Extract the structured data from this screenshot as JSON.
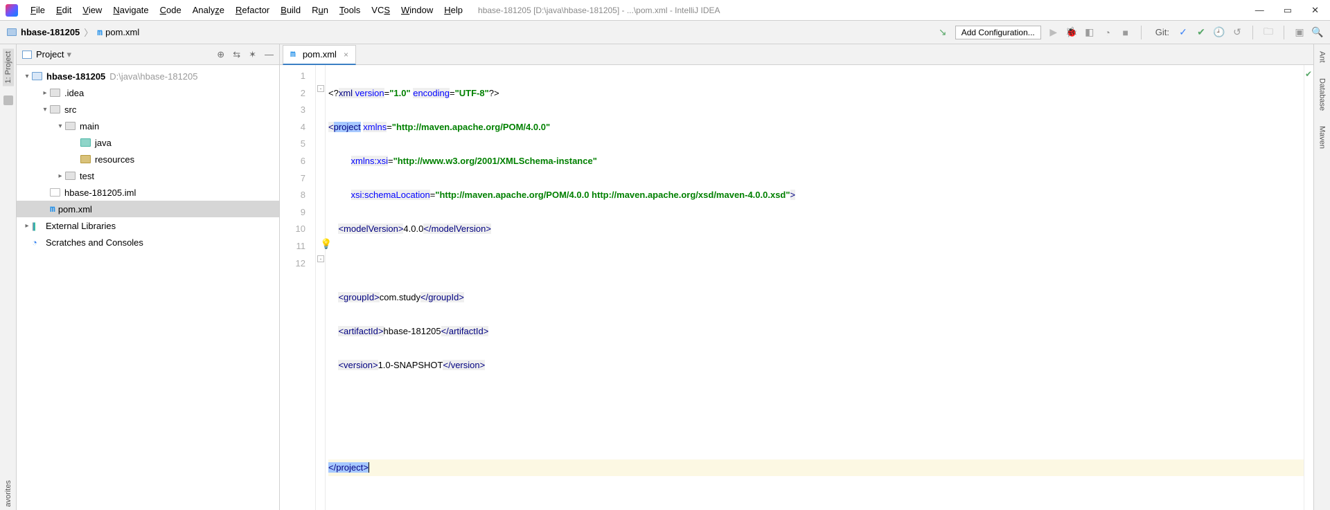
{
  "menus": {
    "file": "File",
    "edit": "Edit",
    "view": "View",
    "navigate": "Navigate",
    "code": "Code",
    "analyze": "Analyze",
    "refactor": "Refactor",
    "build": "Build",
    "run": "Run",
    "tools": "Tools",
    "vcs": "VCS",
    "window": "Window",
    "help": "Help"
  },
  "title_path": "hbase-181205 [D:\\java\\hbase-181205] - ...\\pom.xml - IntelliJ IDEA",
  "breadcrumb": {
    "root": "hbase-181205",
    "file": "pom.xml"
  },
  "toolbar": {
    "add_config": "Add Configuration...",
    "git": "Git:"
  },
  "left_tabs": {
    "project": "1: Project",
    "favorites": "avorites"
  },
  "right_tabs": {
    "ant": "Ant",
    "database": "Database",
    "maven": "Maven"
  },
  "project_header": {
    "title": "Project"
  },
  "tree": {
    "root": "hbase-181205",
    "root_path": "D:\\java\\hbase-181205",
    "idea": ".idea",
    "src": "src",
    "main": "main",
    "java": "java",
    "resources": "resources",
    "test": "test",
    "iml": "hbase-181205.iml",
    "pom": "pom.xml",
    "ext": "External Libraries",
    "scratch": "Scratches and Consoles"
  },
  "editor_tab": {
    "name": "pom.xml"
  },
  "gutter_lines": [
    "1",
    "2",
    "3",
    "4",
    "5",
    "6",
    "7",
    "8",
    "9",
    "10",
    "11",
    "12"
  ],
  "code": {
    "l1": {
      "pre": "<?",
      "xml": "xml ",
      "ver_k": "version",
      "eq1": "=",
      "ver_v": "\"1.0\"",
      "sp1": " ",
      "enc_k": "encoding",
      "eq2": "=",
      "enc_v": "\"UTF-8\"",
      "post": "?>"
    },
    "l2": {
      "open": "<",
      "tag": "project",
      "sp": " ",
      "a1": "xmlns",
      "eq": "=",
      "v1": "\"http://maven.apache.org/POM/4.0.0\""
    },
    "l3": {
      "pad": "         ",
      "a": "xmlns:xsi",
      "eq": "=",
      "v": "\"http://www.w3.org/2001/XMLSchema-instance\""
    },
    "l4": {
      "pad": "         ",
      "a": "xsi:schemaLocation",
      "eq": "=",
      "v": "\"http://maven.apache.org/POM/4.0.0 http://maven.apache.org/xsd/maven-4.0.0.xsd\"",
      "close": ">"
    },
    "l5": {
      "ind": "    ",
      "o": "<",
      "t": "modelVersion",
      "c": ">",
      "x": "4.0.0",
      "o2": "</",
      "t2": "modelVersion",
      "c2": ">"
    },
    "l7": {
      "ind": "    ",
      "o": "<",
      "t": "groupId",
      "c": ">",
      "x": "com.study",
      "o2": "</",
      "t2": "groupId",
      "c2": ">"
    },
    "l8": {
      "ind": "    ",
      "o": "<",
      "t": "artifactId",
      "c": ">",
      "x": "hbase-181205",
      "o2": "</",
      "t2": "artifactId",
      "c2": ">"
    },
    "l9": {
      "ind": "    ",
      "o": "<",
      "t": "version",
      "c": ">",
      "x": "1.0-SNAPSHOT",
      "o2": "</",
      "t2": "version",
      "c2": ">"
    },
    "l12": {
      "o": "</",
      "t": "project",
      "c": ">"
    }
  }
}
